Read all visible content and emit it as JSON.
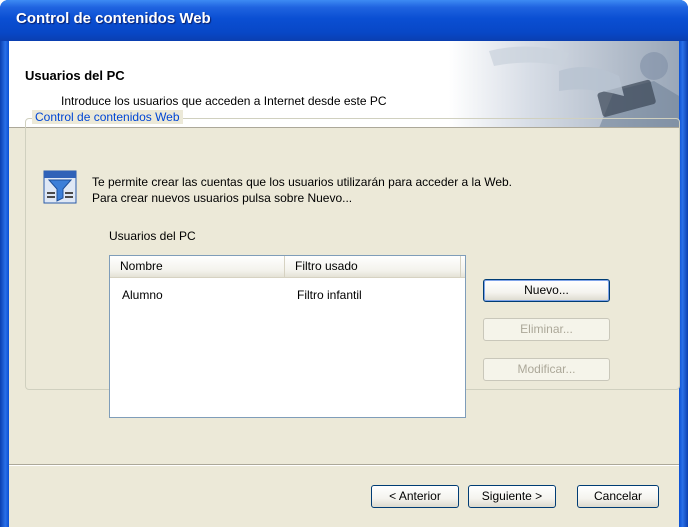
{
  "window": {
    "title": "Control de contenidos Web"
  },
  "header": {
    "title": "Usuarios del PC",
    "subtitle": "Introduce los usuarios que acceden a Internet desde este PC"
  },
  "group": {
    "legend": "Control de contenidos Web",
    "description_line1": "Te permite crear las cuentas que los usuarios utilizarán para acceder a la Web.",
    "description_line2": "Para crear nuevos usuarios pulsa sobre Nuevo...",
    "list_label": "Usuarios del PC"
  },
  "listview": {
    "columns": [
      "Nombre",
      "Filtro usado"
    ],
    "rows": [
      {
        "nombre": "Alumno",
        "filtro": "Filtro infantil"
      }
    ]
  },
  "actions": {
    "new": "Nuevo...",
    "delete": "Eliminar...",
    "modify": "Modificar..."
  },
  "wizard": {
    "back": "< Anterior",
    "next": "Siguiente >",
    "cancel": "Cancelar"
  },
  "colors": {
    "titlebar": "#0a4fd3",
    "client": "#ece9d8",
    "legend_text": "#0046d5"
  }
}
